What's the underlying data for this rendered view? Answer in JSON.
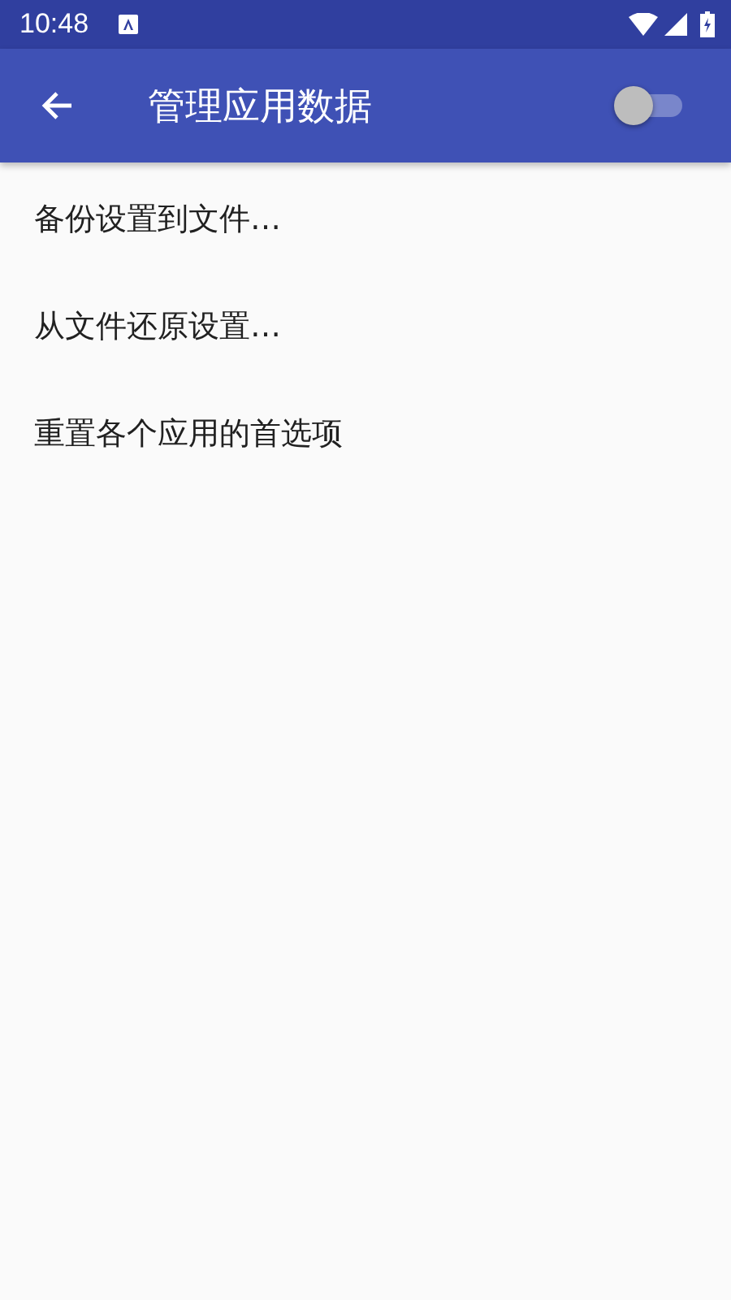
{
  "status_bar": {
    "time": "10:48"
  },
  "app_bar": {
    "title": "管理应用数据",
    "switch": {
      "on": false
    }
  },
  "items": [
    {
      "label": "备份设置到文件…"
    },
    {
      "label": "从文件还原设置…"
    },
    {
      "label": "重置各个应用的首选项"
    }
  ]
}
